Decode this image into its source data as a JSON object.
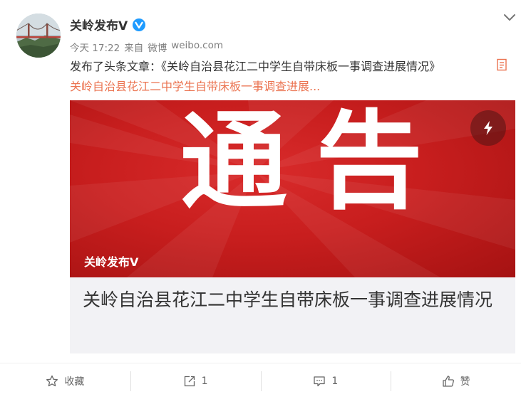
{
  "post": {
    "username": "关岭发布V",
    "meta": {
      "time": "今天 17:22",
      "source_prefix": "来自",
      "source_app": "微博",
      "source_domain": "weibo.com"
    },
    "text": "发布了头条文章：《关岭自治县花江二中学生自带床板一事调查进展情况》",
    "link_text": "关岭自治县花江二中学生自带床板一事调查进展..."
  },
  "card": {
    "image_text": "通告",
    "watermark": "关岭发布V",
    "title": "关岭自治县花江二中学生自带床板一事调查进展情况"
  },
  "actions": {
    "favorite": "收藏",
    "repost_count": "1",
    "comment_count": "1",
    "like": "赞"
  },
  "colors": {
    "link": "#eb7350",
    "verified_badge": "#1e9bff",
    "card_red": "#c81e1e",
    "card_bg": "#f2f2f5"
  }
}
